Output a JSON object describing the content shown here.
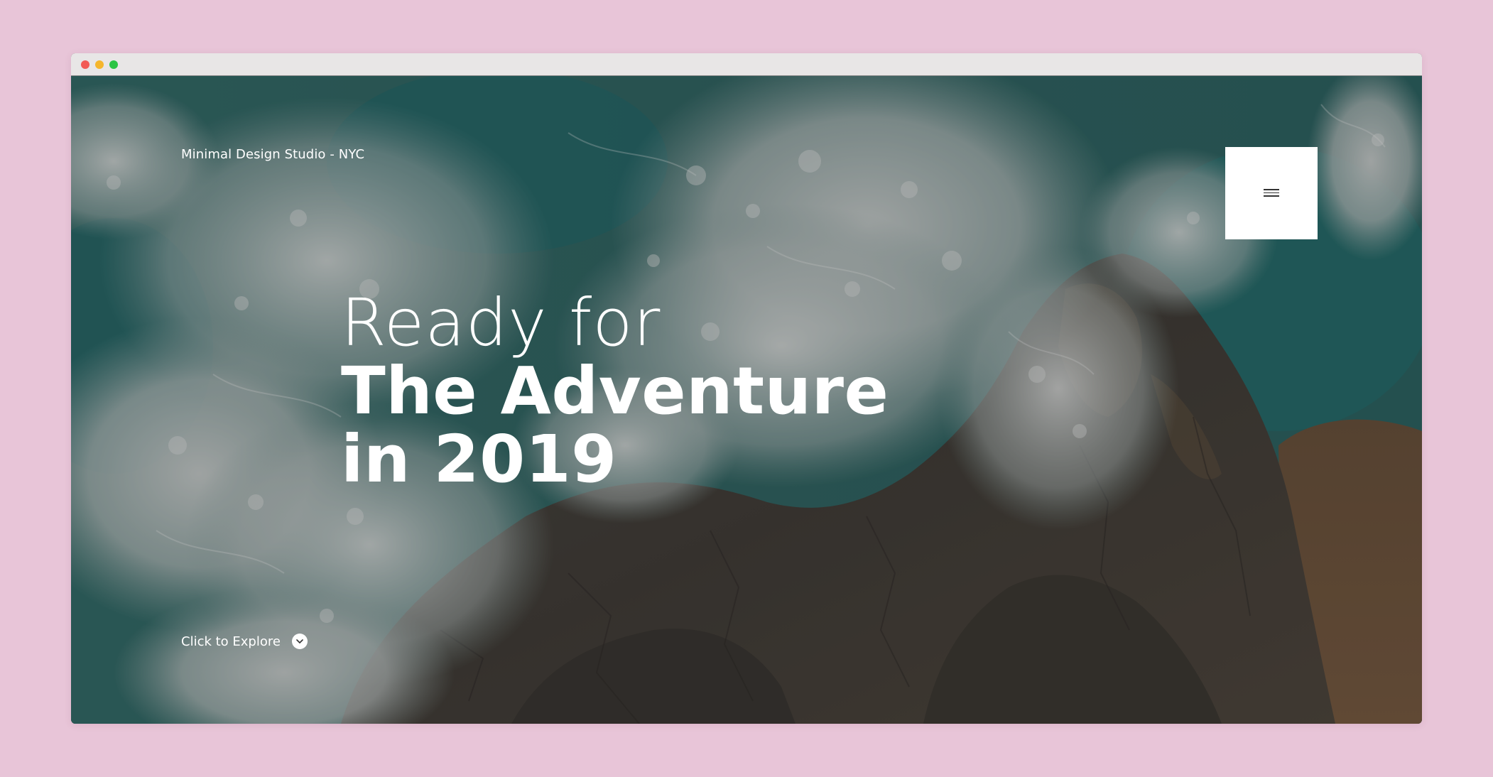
{
  "page": {
    "background_color": "#e8c5d8"
  },
  "window": {
    "controls": [
      "close",
      "minimize",
      "zoom"
    ],
    "colors": {
      "close": "#f25b55",
      "minimize": "#f5b62c",
      "zoom": "#2bc443"
    }
  },
  "header": {
    "brand": "Minimal Design Studio - NYC",
    "menu_icon": "hamburger-icon"
  },
  "hero": {
    "background": "aerial photo of ocean waves crashing on rocky coast",
    "headline_line1": "Ready for",
    "headline_line2": "The Adventure",
    "headline_line3": "in 2019"
  },
  "cta": {
    "label": "Click to Explore",
    "icon": "chevron-down-icon"
  }
}
